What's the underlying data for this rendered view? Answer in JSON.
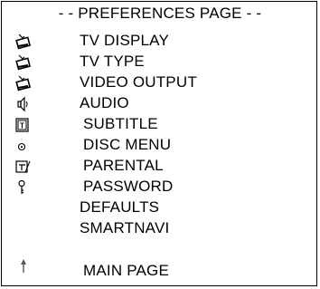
{
  "menu": {
    "title": "- - PREFERENCES PAGE - -",
    "items": [
      {
        "label": "TV DISPLAY",
        "icon": "tv-icon"
      },
      {
        "label": "TV TYPE",
        "icon": "tv-icon"
      },
      {
        "label": "VIDEO OUTPUT",
        "icon": "tv-icon"
      },
      {
        "label": "AUDIO",
        "icon": "speaker-icon"
      },
      {
        "label": "SUBTITLE",
        "icon": "subtitle-icon"
      },
      {
        "label": "DISC MENU",
        "icon": "disc-icon"
      },
      {
        "label": "PARENTAL",
        "icon": "parental-icon"
      },
      {
        "label": "PASSWORD",
        "icon": "key-icon"
      },
      {
        "label": "DEFAULTS",
        "icon": ""
      },
      {
        "label": "SMARTNAVI",
        "icon": ""
      }
    ],
    "main_page": {
      "label": "MAIN PAGE",
      "icon": "up-arrow-icon"
    }
  }
}
